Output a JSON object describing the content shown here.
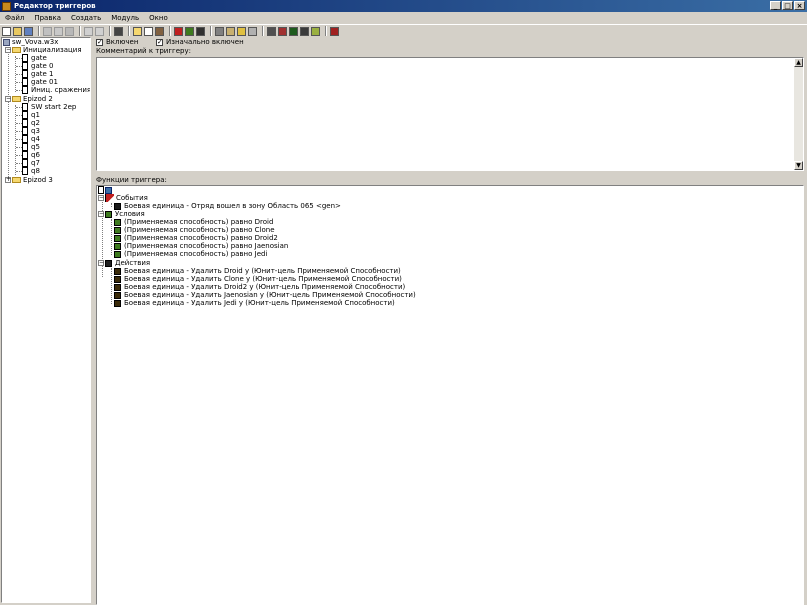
{
  "window": {
    "title": "Редактор триггеров",
    "minimize": "_",
    "maximize": "□",
    "close": "×"
  },
  "menu": [
    "Файл",
    "Правка",
    "Создать",
    "Модуль",
    "Окно"
  ],
  "toolbar_icons": [
    "new-icon",
    "open-icon",
    "save-icon",
    "cut-icon",
    "copy-icon",
    "paste-icon",
    "undo-icon",
    "redo-icon",
    "delete-icon",
    "new-category-icon",
    "new-trigger-icon",
    "new-comment-icon",
    "event-icon",
    "condition-icon",
    "action-icon",
    "terrain-icon",
    "doodad-icon",
    "unit-icon",
    "sound-icon",
    "camera-icon",
    "region-icon",
    "object-icon",
    "import-icon",
    "ai-icon",
    "test-map-icon"
  ],
  "tree": {
    "root": "sw_Vova.w3x",
    "categories": [
      {
        "label": "Инициализация",
        "items": [
          "gate",
          "gate 0",
          "gate 1",
          "gate 01",
          "Иниц. сражения"
        ]
      },
      {
        "label": "Epizod 2",
        "items": [
          "SW start 2ep",
          "q1",
          "q2",
          "q3",
          "q4",
          "q5",
          "q6",
          "q7",
          "q8"
        ]
      },
      {
        "label": "Epizod 3",
        "items": []
      }
    ]
  },
  "trigger": {
    "enabled_label": "Включен",
    "enabled": "✓",
    "initially_on_label": "Изначально включен",
    "initially_on": "✓",
    "comment_label": "Комментарий к триггеру:",
    "functions_label": "Функции триггера:",
    "events_label": "События",
    "events": [
      "Боевая единица - Отряд вошел в зону Область 065 <gen>"
    ],
    "conditions_label": "Условия",
    "conditions": [
      "(Применяемая способность) равно Droid",
      "(Применяемая способность) равно Clone",
      "(Применяемая способность) равно Droid2",
      "(Применяемая способность) равно Jaenosian",
      "(Применяемая способность) равно Jedi"
    ],
    "actions_label": "Действия",
    "actions": [
      "Боевая единица - Удалить Droid у (Юнит-цель Применяемой Способности)",
      "Боевая единица - Удалить Clone  у (Юнит-цель Применяемой Способности)",
      "Боевая единица - Удалить Droid2  у (Юнит-цель Применяемой Способности)",
      "Боевая единица - Удалить Jaenosian  у (Юнит-цель Применяемой Способности)",
      "Боевая единица - Удалить Jedi  у (Юнит-цель Применяемой Способности)"
    ]
  },
  "colors": {
    "titlebar": "#0a246a",
    "window_bg": "#d4d0c8",
    "panel_bg": "#ffffff"
  }
}
